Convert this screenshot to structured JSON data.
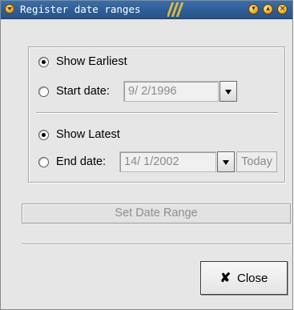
{
  "window": {
    "title": "Register date ranges"
  },
  "range": {
    "show_earliest_label": "Show Earliest",
    "show_earliest_checked": true,
    "start_date_label": "Start date:",
    "start_date_value": "9/ 2/1996",
    "show_latest_label": "Show Latest",
    "show_latest_checked": true,
    "end_date_label": "End date:",
    "end_date_value": "14/ 1/2002",
    "today_label": "Today"
  },
  "actions": {
    "set_range_label": "Set Date Range",
    "close_label": "Close",
    "close_icon": "✘"
  },
  "icons": {
    "window_menu": "chevron-down-icon",
    "minimize": "minimize-icon",
    "maximize": "maximize-icon",
    "close": "close-icon"
  },
  "colors": {
    "titlebar": "#2f5f97",
    "titlebar_accent": "#f0c23a",
    "window_bg": "#e6e6e6"
  }
}
